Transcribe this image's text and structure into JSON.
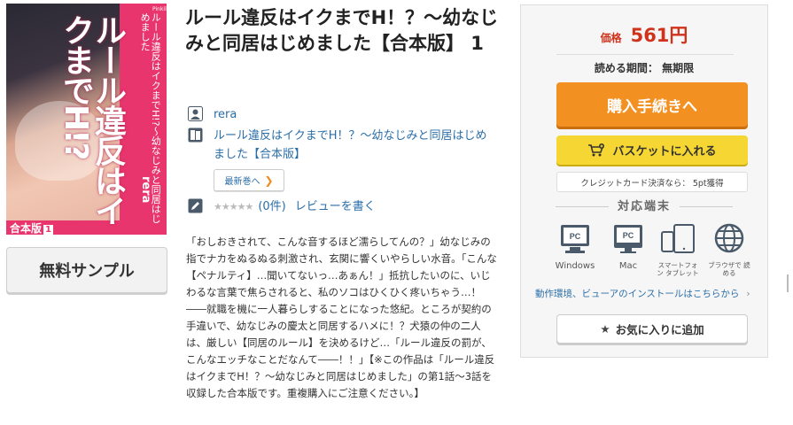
{
  "cover": {
    "big_title": "ルール違反はイクまでH!?",
    "small_title": "ルール違反はイクまでH!?〜幼なじみと同居はじめました",
    "publisher": "Pinkil",
    "author": "rera",
    "badge_label": "合本版",
    "badge_num": "1"
  },
  "sample_button": "無料サンプル",
  "book": {
    "title": "ルール違反はイクまでH！？〜幼なじみと同居はじめました【合本版】 1",
    "author": "rera",
    "series": "ルール違反はイクまでH！？〜幼なじみと同居はじめました【合本版】",
    "latest_label": "最新巻へ",
    "stars": "★★★★★",
    "review_count": "(0件)",
    "review_link": "レビューを書く",
    "description": "「おしおきされて、こんな音するほど濡らしてんの？」幼なじみの指でナカをぬるぬる刺激され、玄関に響くいやらしい水音。「こんな【ペナルティ】…聞いてないっ…あぁん！」抵抗したいのに、いじわるな言葉で焦らされると、私のソコはひくひく疼いちゃう…！――就職を機に一人暮らしすることになった悠紀。ところが契約の手違いで、幼なじみの慶太と同居するハメに！？犬猿の仲の二人は、厳しい【同居のルール】を決めるけど…「ルール違反の罰が、こんなエッチなことだなんて――！！」【※この作品は「ルール違反はイクまでH！？〜幼なじみと同居はじめました」の第1話〜3話を収録した合本版です。重複購入にご注意ください。】"
  },
  "purchase": {
    "price_label": "価格",
    "price_value": "561円",
    "period": "読める期間： 無期限",
    "buy_label": "購入手続きへ",
    "basket_label": "バスケットに入れる",
    "points": "クレジットカード決済なら： 5pt獲得",
    "devices_heading": "対応端末",
    "devices": [
      {
        "icon": "windows-pc-icon",
        "label": "Windows"
      },
      {
        "icon": "mac-pc-icon",
        "label": "Mac"
      },
      {
        "icon": "smartphone-tablet-icon",
        "label": "スマートフォン タブレット"
      },
      {
        "icon": "browser-globe-icon",
        "label": "ブラウザで 読める"
      }
    ],
    "env_link": "動作環境、ビューアのインストールはこちらから",
    "favorite_label": "お気に入りに追加"
  },
  "colors": {
    "price": "#d0331c",
    "buy": "#f29021",
    "basket": "#f6d632",
    "link": "#2a6ea8",
    "cover": "#e8356d"
  }
}
